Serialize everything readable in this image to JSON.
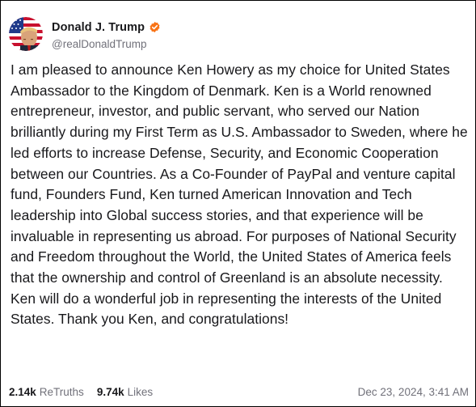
{
  "post": {
    "author": {
      "display_name": "Donald J. Trump",
      "handle": "@realDonaldTrump",
      "verified_icon": "verified-badge-icon",
      "verified_color": "#f97316"
    },
    "body": "I am pleased to announce Ken Howery as my choice for United States Ambassador to the Kingdom of Denmark. Ken is a World renowned entrepreneur, investor, and public servant, who served our Nation brilliantly during my First Term as U.S. Ambassador to Sweden, where he led efforts to increase Defense, Security, and Economic Cooperation between our Countries. As a Co-Founder of PayPal and venture capital fund, Founders Fund, Ken turned American Innovation and Tech leadership into Global success stories, and that experience will be invaluable in representing us abroad. For purposes of National Security and Freedom throughout the World, the United States of America feels that the ownership and control of Greenland is an absolute necessity. Ken will do a wonderful job in representing the interests of the United States. Thank you Ken, and congratulations!",
    "stats": {
      "retruths_count": "2.14k",
      "retruths_label": "ReTruths",
      "likes_count": "9.74k",
      "likes_label": "Likes"
    },
    "timestamp": "Dec 23, 2024, 3:41 AM"
  },
  "colors": {
    "text_primary": "#18181b",
    "text_secondary": "#71717a",
    "border": "#000000"
  }
}
